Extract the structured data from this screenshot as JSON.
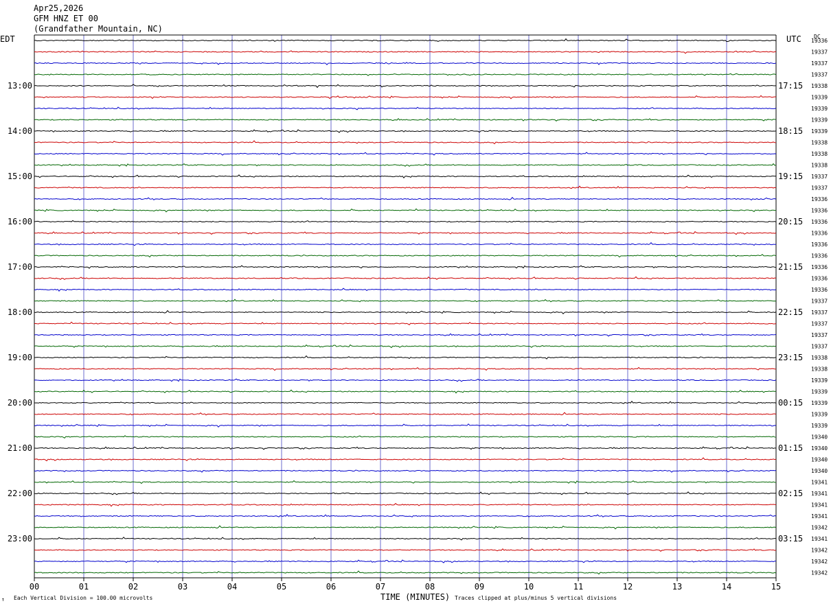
{
  "header": {
    "date": "Apr25,2026",
    "station": "GFM HNZ ET 00",
    "location": "(Grandfather Mountain, NC)"
  },
  "labels": {
    "left_tz": "EDT",
    "right_tz": "UTC",
    "dc_header": "DC",
    "xlabel": "TIME (MINUTES)",
    "scale_note": "Each Vertical Division =  100.00 microvolts",
    "clip_note": "Traces clipped at plus/minus 5 vertical divisions",
    "corner_mark": "↑"
  },
  "colors": {
    "trace_cycle": [
      "#000000",
      "#cc0000",
      "#0000cc",
      "#006600"
    ],
    "vertical_grid": "#6b6bcc",
    "frame": "#000000"
  },
  "chart_data": {
    "type": "line",
    "title": "",
    "xlabel": "TIME (MINUTES)",
    "ylabel": "",
    "xlim": [
      0,
      15
    ],
    "x_ticks": [
      "00",
      "01",
      "02",
      "03",
      "04",
      "05",
      "06",
      "07",
      "08",
      "09",
      "10",
      "11",
      "12",
      "13",
      "14",
      "15"
    ],
    "left_hour_labels": [
      "13:00",
      "14:00",
      "15:00",
      "16:00",
      "17:00",
      "18:00",
      "19:00",
      "20:00",
      "21:00",
      "22:00",
      "23:00"
    ],
    "right_hour_labels": [
      "17:15",
      "18:15",
      "19:15",
      "20:15",
      "21:15",
      "22:15",
      "23:15",
      "00:15",
      "01:15",
      "02:15",
      "03:15"
    ],
    "trace_count": 48,
    "traces_per_hour": 4,
    "minutes_per_trace": 15,
    "dc_offsets": [
      19336,
      19337,
      19337,
      19337,
      19338,
      19339,
      19339,
      19339,
      19339,
      19338,
      19338,
      19338,
      19337,
      19337,
      19336,
      19336,
      19336,
      19336,
      19336,
      19336,
      19336,
      19336,
      19336,
      19337,
      19337,
      19337,
      19337,
      19337,
      19338,
      19338,
      19339,
      19339,
      19339,
      19339,
      19339,
      19340,
      19340,
      19340,
      19340,
      19341,
      19341,
      19341,
      19341,
      19342,
      19341,
      19342,
      19342,
      19342
    ],
    "grid": true
  }
}
